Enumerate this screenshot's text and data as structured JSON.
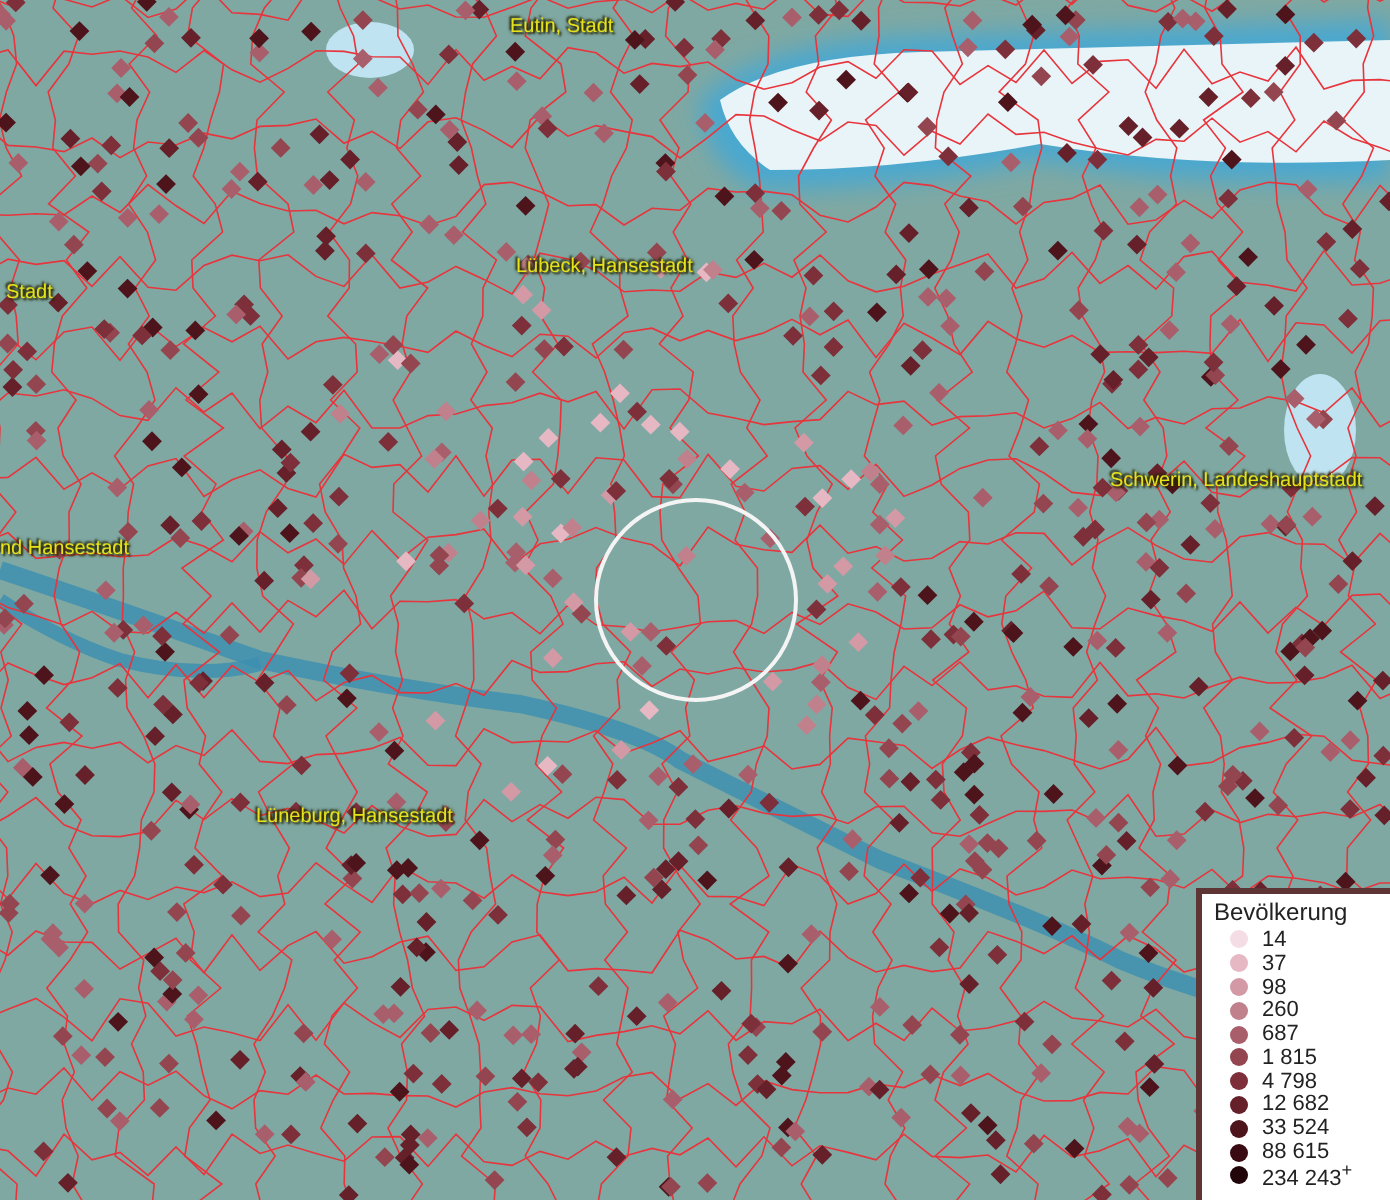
{
  "map": {
    "place_labels": [
      {
        "text": "Eutin, Stadt"
      },
      {
        "text": "Lübeck, Hansestadt"
      },
      {
        "text": "Stadt"
      },
      {
        "text": "nd Hansestadt"
      },
      {
        "text": "Schwerin, Landeshauptstadt"
      },
      {
        "text": "Lüneburg, Hansestadt"
      }
    ]
  },
  "legend": {
    "title": "Bevölkerung",
    "items": [
      {
        "label": "14",
        "color": "#f5dde6"
      },
      {
        "label": "37",
        "color": "#e6b8c4"
      },
      {
        "label": "98",
        "color": "#d39aa6"
      },
      {
        "label": "260",
        "color": "#c0808c"
      },
      {
        "label": "687",
        "color": "#a95f6b"
      },
      {
        "label": "1 815",
        "color": "#944650"
      },
      {
        "label": "4 798",
        "color": "#7d2f3a"
      },
      {
        "label": "12 682",
        "color": "#65202a"
      },
      {
        "label": "33 524",
        "color": "#4e141c"
      },
      {
        "label": "88 615",
        "color": "#3a0a12"
      },
      {
        "label": "234 243$^{+}$",
        "color": "#22050a"
      }
    ]
  }
}
